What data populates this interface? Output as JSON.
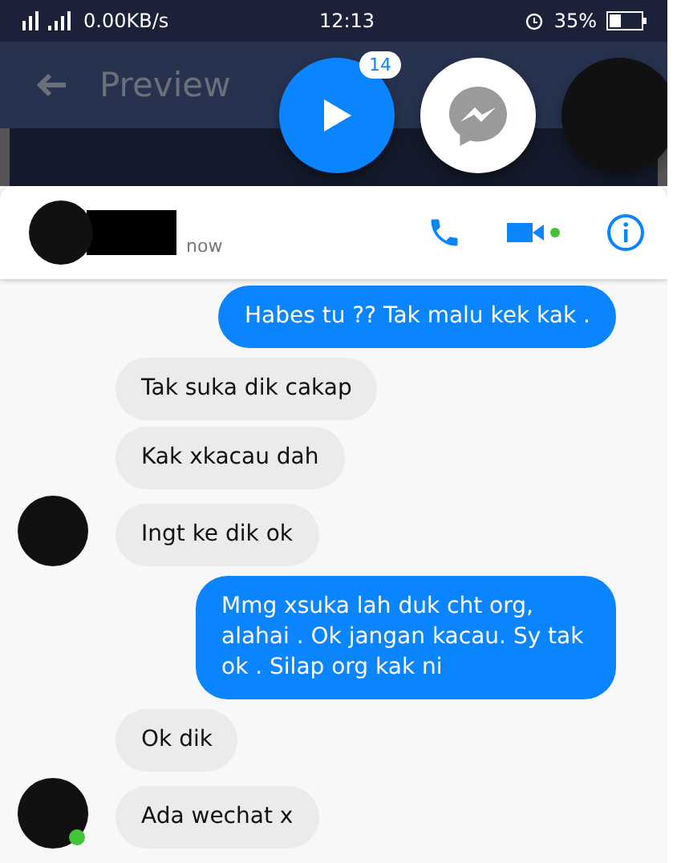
{
  "status_bar": {
    "network_speed": "0.00KB/s",
    "time": "12:13",
    "battery": "35%"
  },
  "app_bar": {
    "title": "Preview"
  },
  "chat_heads": {
    "badge": "14"
  },
  "conversation_header": {
    "status": "now",
    "video_online": true
  },
  "messages": [
    {
      "kind": "sent",
      "text": "Habes tu ?? Tak malu kek kak ."
    },
    {
      "kind": "received",
      "text": "Tak suka dik cakap",
      "avatar": false
    },
    {
      "kind": "received",
      "text": "Kak xkacau dah",
      "avatar": false
    },
    {
      "kind": "received",
      "text": "Ingt ke dik ok",
      "avatar": true
    },
    {
      "kind": "sent",
      "text": "Mmg xsuka lah duk cht org, alahai . Ok jangan kacau.  Sy tak ok . Silap org kak ni"
    },
    {
      "kind": "received",
      "text": "Ok dik",
      "avatar": false
    },
    {
      "kind": "received",
      "text": "Ada wechat x",
      "avatar": true,
      "online": true
    }
  ]
}
